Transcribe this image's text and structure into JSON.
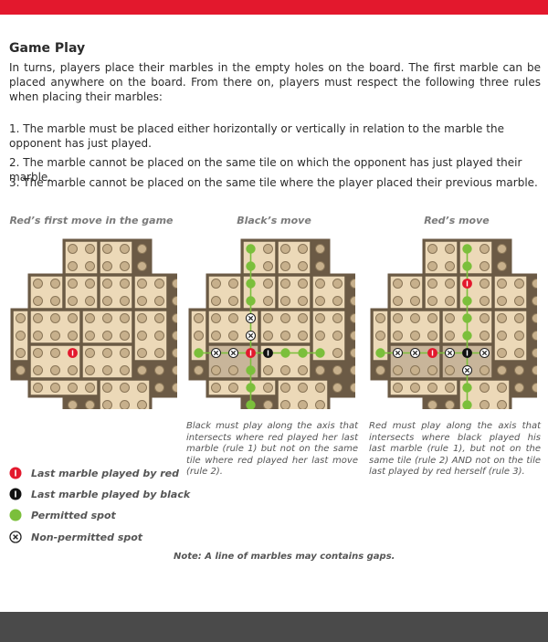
{
  "page": {
    "heading": "Game Play",
    "intro": "In turns, players place their marbles in the empty holes on the board. The first marble can be placed anywhere on the board. From there on, players must respect the following three rules when placing their marbles:",
    "rules": [
      "1. The marble must be placed either horizontally or vertically in relation to the marble the opponent has just played.",
      "2. The marble cannot be placed on the same tile on which the opponent has just played their marble.",
      "3. The marble cannot be placed on the same tile where the player placed their previous marble."
    ]
  },
  "diagrams": [
    {
      "caption": "Red’s first move in the game",
      "description": ""
    },
    {
      "caption": "Black’s move",
      "description": "Black must play along the axis that intersects where red played her last marble (rule 1) but not on the same tile where red played her last move (rule 2)."
    },
    {
      "caption": "Red’s move",
      "description": "Red must play along the axis that intersects where black played his last marble (rule 1), but not on the same tile (rule 2) AND not on the tile last played by red herself (rule 3)."
    }
  ],
  "legend": [
    {
      "label": "Last marble played by red",
      "icon": "red-marble-icon"
    },
    {
      "label": "Last marble played by black",
      "icon": "black-marble-icon"
    },
    {
      "label": "Permitted spot",
      "icon": "permitted-spot-icon"
    },
    {
      "label": "Non-permitted spot",
      "icon": "non-permitted-spot-icon"
    }
  ],
  "note": "Note: A line of marbles may contains gaps.",
  "colors": {
    "accent_red": "#e3182d",
    "footer_gray": "#4a4a4a",
    "tile_fill": "#ecd9b8",
    "tile_border": "#6b5a45",
    "hole_fill": "#c7b08c",
    "shaded_tile": "#c8b59a",
    "permitted_green": "#7bbf3b"
  }
}
